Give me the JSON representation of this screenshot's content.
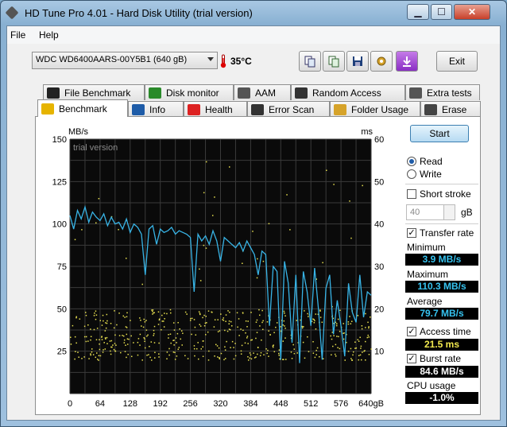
{
  "window": {
    "title": "HD Tune Pro 4.01 - Hard Disk Utility (trial version)"
  },
  "titlebar_buttons": {
    "minimize": "▁",
    "maximize": "☐",
    "close": "✕"
  },
  "menu": {
    "file": "File",
    "help": "Help"
  },
  "toolbar": {
    "drive": "WDC WD6400AARS-00Y5B1 (640 gB)",
    "temperature": "35°C",
    "exit_label": "Exit",
    "icons": [
      "copy-icon",
      "copy-all-icon",
      "save-icon",
      "options-icon",
      "download-icon"
    ]
  },
  "tabs_row1": [
    "File Benchmark",
    "Disk monitor",
    "AAM",
    "Random Access",
    "Extra tests"
  ],
  "tabs_row2": [
    "Benchmark",
    "Info",
    "Health",
    "Error Scan",
    "Folder Usage",
    "Erase"
  ],
  "active_tab": "Benchmark",
  "side": {
    "start_label": "Start",
    "read_label": "Read",
    "write_label": "Write",
    "short_stroke_label": "Short stroke",
    "short_stroke_value": "40",
    "short_stroke_unit": "gB",
    "transfer_rate_label": "Transfer rate",
    "minimum_label": "Minimum",
    "minimum_value": "3.9 MB/s",
    "maximum_label": "Maximum",
    "maximum_value": "110.3 MB/s",
    "average_label": "Average",
    "average_value": "79.7 MB/s",
    "access_time_label": "Access time",
    "access_time_value": "21.5 ms",
    "burst_rate_label": "Burst rate",
    "burst_rate_value": "84.6 MB/s",
    "cpu_usage_label": "CPU usage",
    "cpu_usage_value": "-1.0%"
  },
  "colors": {
    "transfer_line": "#38b4e6",
    "access_dots": "#e8e050",
    "plot_bg": "#0a0a0a"
  },
  "chart_data": {
    "type": "line",
    "watermark": "trial version",
    "y_left_label": "MB/s",
    "y_right_label": "ms",
    "y_left_ticks": [
      "150",
      "125",
      "100",
      "75",
      "50",
      "25"
    ],
    "y_right_ticks": [
      "60",
      "50",
      "40",
      "30",
      "20",
      "10"
    ],
    "x_ticks": [
      "0",
      "64",
      "128",
      "192",
      "256",
      "320",
      "384",
      "448",
      "512",
      "576",
      "640gB"
    ],
    "xlim": [
      0,
      640
    ],
    "ylim_left": [
      0,
      150
    ],
    "ylim_right": [
      0,
      60
    ],
    "grid": true,
    "series": [
      {
        "name": "Transfer rate",
        "x": [
          0,
          8,
          16,
          24,
          32,
          40,
          48,
          56,
          64,
          72,
          80,
          88,
          96,
          104,
          112,
          120,
          128,
          136,
          144,
          152,
          160,
          168,
          176,
          184,
          192,
          200,
          208,
          216,
          224,
          232,
          240,
          248,
          256,
          264,
          272,
          280,
          288,
          296,
          304,
          312,
          320,
          328,
          336,
          344,
          352,
          360,
          368,
          376,
          384,
          392,
          400,
          408,
          416,
          424,
          432,
          440,
          448,
          456,
          464,
          472,
          480,
          488,
          496,
          504,
          512,
          520,
          528,
          536,
          544,
          552,
          560,
          568,
          576,
          584,
          592,
          600,
          608,
          616,
          624,
          632,
          640
        ],
        "y": [
          105,
          97,
          108,
          103,
          110,
          101,
          107,
          104,
          102,
          106,
          99,
          104,
          100,
          101,
          97,
          103,
          95,
          100,
          98,
          94,
          70,
          97,
          99,
          88,
          97,
          95,
          96,
          98,
          94,
          96,
          95,
          94,
          92,
          60,
          94,
          90,
          93,
          88,
          96,
          90,
          78,
          92,
          90,
          88,
          86,
          89,
          84,
          90,
          86,
          82,
          70,
          84,
          82,
          40,
          75,
          72,
          20,
          78,
          65,
          30,
          70,
          18,
          72,
          60,
          40,
          74,
          50,
          20,
          62,
          70,
          35,
          55,
          40,
          22,
          65,
          48,
          42,
          70,
          45,
          60,
          58
        ]
      },
      {
        "name": "Access time",
        "type": "scatter",
        "axis": "right",
        "note": "dense band of random-access samples, mostly 8–20 ms",
        "y_range": [
          8,
          20
        ]
      }
    ]
  }
}
